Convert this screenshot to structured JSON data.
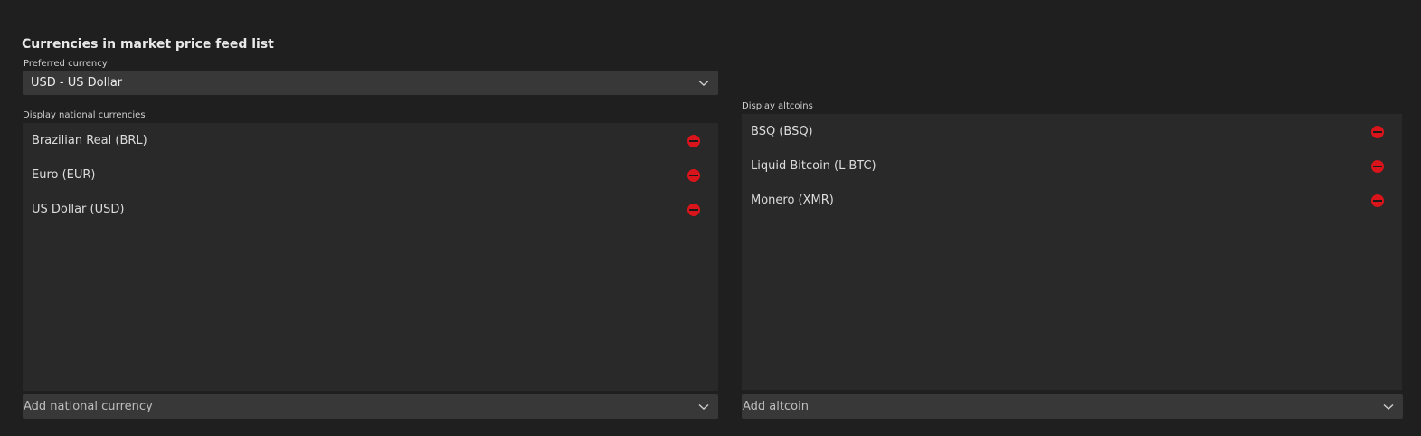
{
  "section": {
    "title": "Currencies in market price feed list"
  },
  "preferred": {
    "label": "Preferred currency",
    "value": "USD - US Dollar",
    "icon": "chevron-down-icon"
  },
  "national": {
    "label": "Display national currencies",
    "items": [
      {
        "label": "Brazilian Real (BRL)",
        "icon": "remove-icon"
      },
      {
        "label": "Euro (EUR)",
        "icon": "remove-icon"
      },
      {
        "label": "US Dollar (USD)",
        "icon": "remove-icon"
      }
    ],
    "add_placeholder": "Add national currency"
  },
  "altcoins": {
    "label": "Display altcoins",
    "items": [
      {
        "label": "BSQ (BSQ)",
        "icon": "remove-icon"
      },
      {
        "label": "Liquid Bitcoin (L-BTC)",
        "icon": "remove-icon"
      },
      {
        "label": "Monero (XMR)",
        "icon": "remove-icon"
      }
    ],
    "add_placeholder": "Add altcoin"
  },
  "colors": {
    "background": "#1f1f1f",
    "panel": "#292929",
    "input": "#383838",
    "remove_accent": "#d9141a"
  }
}
